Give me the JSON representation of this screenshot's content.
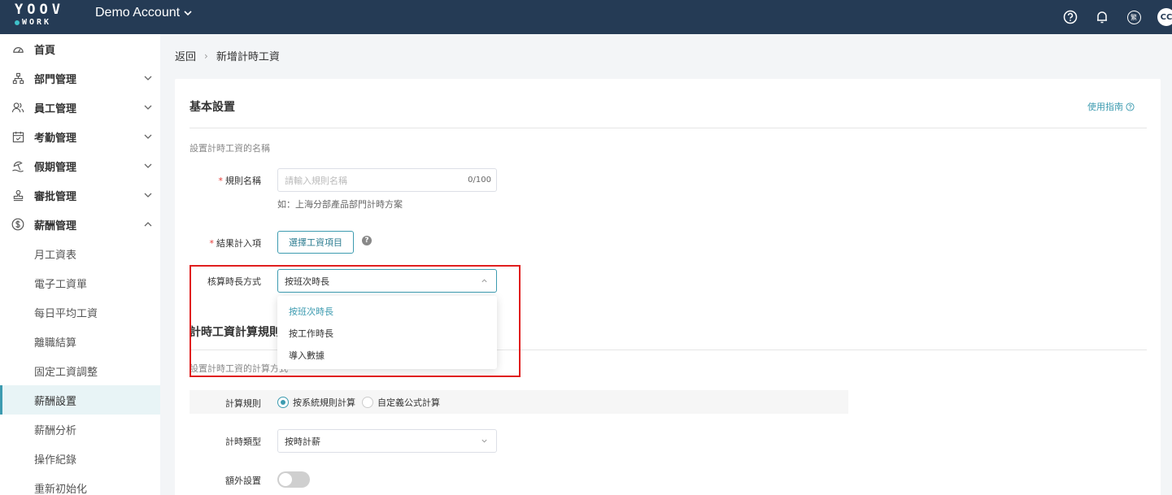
{
  "topbar": {
    "logo_top": "YOOV",
    "logo_bottom": "WORK",
    "account": "Demo Account",
    "avatar": "CC",
    "lang": "繁"
  },
  "sidebar": {
    "items": [
      {
        "label": "首頁",
        "icon": "dashboard-icon"
      },
      {
        "label": "部門管理",
        "icon": "org-chart-icon"
      },
      {
        "label": "員工管理",
        "icon": "users-icon"
      },
      {
        "label": "考勤管理",
        "icon": "calendar-check-icon"
      },
      {
        "label": "假期管理",
        "icon": "beach-icon"
      },
      {
        "label": "審批管理",
        "icon": "stamp-icon"
      },
      {
        "label": "薪酬管理",
        "icon": "dollar-circle-icon"
      }
    ],
    "sub_items": [
      "月工資表",
      "電子工資單",
      "每日平均工資",
      "離職結算",
      "固定工資調整",
      "薪酬設置",
      "薪酬分析",
      "操作紀錄",
      "重新初始化"
    ]
  },
  "breadcrumb": {
    "back": "返回",
    "sep": "›",
    "current": "新增計時工資"
  },
  "basic": {
    "title": "基本設置",
    "guide": "使用指南",
    "hint": "設置計時工資的名稱",
    "rule_name_label": "規則名稱",
    "rule_name_placeholder": "請輸入規則名稱",
    "rule_name_count": "0/100",
    "rule_name_example": "如：上海分部產品部門計時方案",
    "result_label": "結果計入項",
    "select_item_button": "選擇工資項目",
    "calc_mode_label": "核算時長方式",
    "calc_mode_value": "按班次時長",
    "calc_mode_options": [
      "按班次時長",
      "按工作時長",
      "導入數據"
    ]
  },
  "calc": {
    "title": "計時工資計算規則",
    "hint": "設置計時工資的計算方式",
    "rule_label": "計算規則",
    "rule_option_1": "按系統規則計算",
    "rule_option_2": "自定義公式計算",
    "type_label": "計時類型",
    "type_value": "按時計薪",
    "extra_label": "額外設置"
  },
  "colors": {
    "header_bg": "#253b55",
    "accent": "#3d9bb0",
    "highlight": "#e01e1e"
  }
}
